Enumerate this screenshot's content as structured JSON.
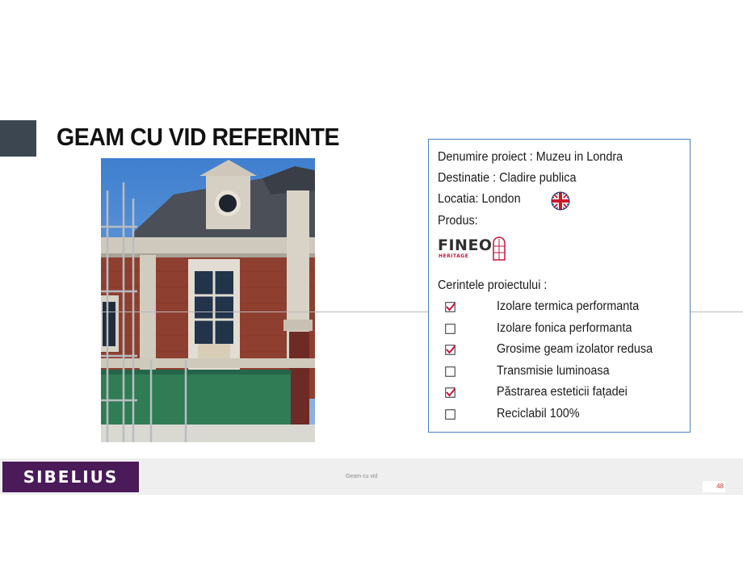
{
  "slide": {
    "title": "GEAM CU VID REFERINTE"
  },
  "project": {
    "name_line": "Denumire proiect : Muzeu in Londra",
    "destination_line": "Destinatie : Cladire publica",
    "location_line": "Locatia: London",
    "product_label": "Produs:",
    "product_logo_text": "FINEO",
    "product_logo_subtext": "HERITAGE",
    "requirements_title": "Cerintele proiectului :"
  },
  "requirements": [
    {
      "label": "Izolare termica performanta",
      "checked": true
    },
    {
      "label": "Izolare fonica performanta",
      "checked": false
    },
    {
      "label": "Grosime geam izolator redusa",
      "checked": true
    },
    {
      "label": "Transmisie luminoasa",
      "checked": false
    },
    {
      "label": "Păstrarea esteticii fațadei",
      "checked": true
    },
    {
      "label": "Reciclabil 100%",
      "checked": false
    }
  ],
  "footer": {
    "brand": "SIBELIUS",
    "center_text": "Geam cu vid",
    "page_number": "48"
  },
  "colors": {
    "accent_block": "#3b4650",
    "brand_purple": "#4a1a59",
    "box_border": "#4a7fc1",
    "check_red": "#c8143c",
    "page_number": "#c0392b"
  },
  "icons": {
    "flag": "uk-flag-icon",
    "checked": "checkbox-checked-icon",
    "unchecked": "checkbox-empty-icon"
  }
}
